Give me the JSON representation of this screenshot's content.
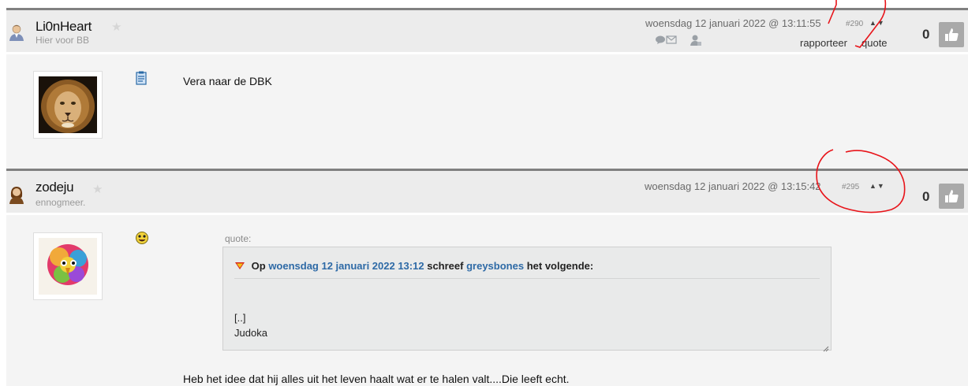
{
  "posts": [
    {
      "username": "Li0nHeart",
      "user_subtitle": "Hier voor BB",
      "timestamp": "woensdag 12 januari 2022 @ 13:11:55",
      "post_number": "#290",
      "actions": {
        "report": "rapporteer",
        "quote": "quote"
      },
      "vote_count": "0",
      "text": "Vera naar de DBK"
    },
    {
      "username": "zodeju",
      "user_subtitle": "ennogmeer.",
      "timestamp": "woensdag 12 januari 2022 @ 13:15:42",
      "post_number": "#295",
      "vote_count": "0",
      "quote": {
        "label": "quote:",
        "prefix": "Op",
        "date_link": "woensdag 12 januari 2022 13:12",
        "middle": "schreef",
        "author_link": "greysbones",
        "suffix": "het volgende:",
        "lines": [
          "[..]",
          "Judoka"
        ]
      },
      "text": "Heb het idee dat hij alles uit het leven haalt wat er te halen valt....Die leeft echt."
    }
  ],
  "colors": {
    "link": "#2e6aa6",
    "annotation": "#e8141a",
    "vote_button": "#a9a9a9"
  }
}
